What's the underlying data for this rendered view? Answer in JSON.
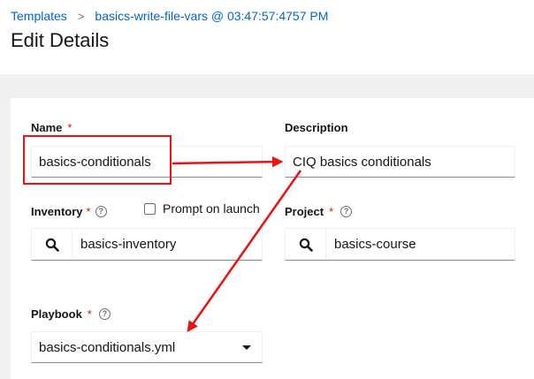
{
  "breadcrumb": {
    "parent": "Templates",
    "separator": ">",
    "current": "basics-write-file-vars @ 03:47:57:4757 PM"
  },
  "page_title": "Edit Details",
  "form": {
    "name": {
      "label": "Name",
      "required_mark": "*",
      "value": "basics-conditionals"
    },
    "description": {
      "label": "Description",
      "value": "CIQ basics conditionals"
    },
    "inventory": {
      "label": "Inventory",
      "required_mark": "*",
      "value": "basics-inventory",
      "prompt_on_launch_label": "Prompt on launch"
    },
    "project": {
      "label": "Project",
      "required_mark": "*",
      "value": "basics-course"
    },
    "playbook": {
      "label": "Playbook",
      "required_mark": "*",
      "value": "basics-conditionals.yml"
    }
  },
  "icons": {
    "help": "?",
    "search": "search-icon",
    "caret": "caret-down-icon"
  },
  "colors": {
    "link": "#0066cc",
    "required": "#c9190b",
    "annotation": "#ee1111",
    "page_bg": "#f0f0f0"
  }
}
